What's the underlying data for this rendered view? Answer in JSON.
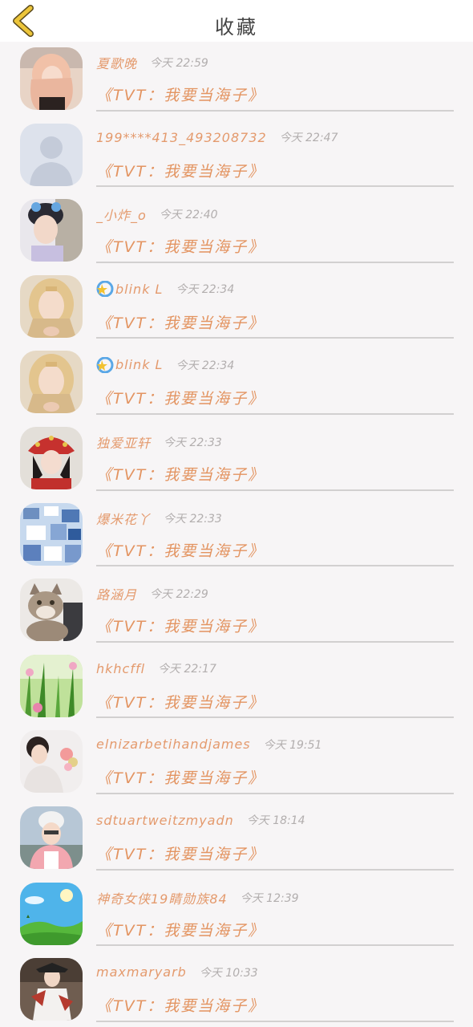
{
  "header": {
    "title": "收藏",
    "back_icon": "chevron-left-icon"
  },
  "colors": {
    "name": "#e49a6d",
    "content": "#e39461",
    "time": "#b2aeae",
    "back_icon": "#ecc53a"
  },
  "items": [
    {
      "name": "夏歌晚",
      "time": "今天 22:59",
      "content": "《TVT：我要当海子》",
      "badge": false,
      "avatar": "woman-pink-hair"
    },
    {
      "name": "199****413_493208732",
      "time": "今天 22:47",
      "content": "《TVT：我要当海子》",
      "badge": false,
      "avatar": "default-silhouette"
    },
    {
      "name": "_小炸_o",
      "time": "今天 22:40",
      "content": "《TVT：我要当海子》",
      "badge": false,
      "avatar": "boy-with-cat-ears"
    },
    {
      "name": "blink L",
      "time": "今天 22:34",
      "content": "《TVT：我要当海子》",
      "badge": true,
      "avatar": "blonde-woman"
    },
    {
      "name": "blink L",
      "time": "今天 22:34",
      "content": "《TVT：我要当海子》",
      "badge": true,
      "avatar": "blonde-woman"
    },
    {
      "name": "独爱亚轩",
      "time": "今天 22:33",
      "content": "《TVT：我要当海子》",
      "badge": false,
      "avatar": "woman-red-headdress"
    },
    {
      "name": "爆米花丫",
      "time": "今天 22:33",
      "content": "《TVT：我要当海子》",
      "badge": false,
      "avatar": "blue-collage"
    },
    {
      "name": "路涵月",
      "time": "今天 22:29",
      "content": "《TVT：我要当海子》",
      "badge": false,
      "avatar": "cat-photo"
    },
    {
      "name": "hkhcffl",
      "time": "今天 22:17",
      "content": "《TVT：我要当海子》",
      "badge": false,
      "avatar": "green-grass-flowers"
    },
    {
      "name": "elnizarbetihandjames",
      "time": "今天 19:51",
      "content": "《TVT：我要当海子》",
      "badge": false,
      "avatar": "girl-with-flowers"
    },
    {
      "name": "sdtuartweitzmyadn",
      "time": "今天 18:14",
      "content": "《TVT：我要当海子》",
      "badge": false,
      "avatar": "woman-white-hat"
    },
    {
      "name": "神奇女侠19睛勋族84",
      "time": "今天 12:39",
      "content": "《TVT：我要当海子》",
      "badge": false,
      "avatar": "blue-sky-field"
    },
    {
      "name": "maxmaryarb",
      "time": "今天 10:33",
      "content": "《TVT：我要当海子》",
      "badge": false,
      "avatar": "costume-figure"
    }
  ]
}
